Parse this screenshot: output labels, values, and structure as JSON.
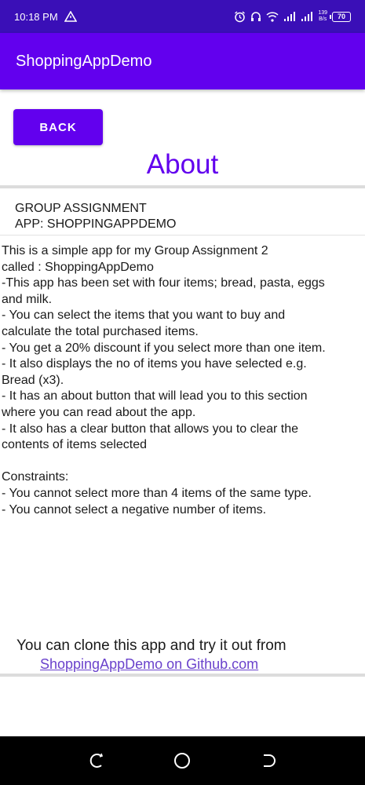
{
  "status_bar": {
    "time": "10:18 PM",
    "speed_value": "139",
    "speed_unit": "B/s",
    "battery": "70",
    "icons": [
      "warning-triangle-icon",
      "alarm-icon",
      "headset-icon",
      "wifi-icon",
      "signal-icon",
      "signal-icon",
      "battery-icon"
    ]
  },
  "app_bar": {
    "title": "ShoppingAppDemo"
  },
  "back_button": {
    "label": "BACK"
  },
  "page_title": "About",
  "group": {
    "line1": "GROUP ASSIGNMENT",
    "line2": "APP: SHOPPINGAPPDEMO"
  },
  "description": "This is a simple app for my Group Assignment 2\ncalled : ShoppingAppDemo\n-This app has been set with four items; bread, pasta, eggs\nand milk.\n- You can select the items that you want to buy and\ncalculate the total purchased items.\n- You get a 20% discount if you select more than one item.\n- It also displays the no of items you have selected e.g.\nBread (x3).\n- It has an about button that will lead you to this section\nwhere you can read about the app.\n- It also has a clear button that allows you to clear the\ncontents of items selected\n\nConstraints:\n- You cannot select more than 4 items of the same type.\n- You cannot select a negative number of items.",
  "clone_text": "You can clone this app and try it out from",
  "github_link": "ShoppingAppDemo on Github.com",
  "colors": {
    "status_bar": "#3a0fb7",
    "primary": "#6200ee",
    "link": "#6a42cc",
    "nav_bar": "#000000"
  },
  "nav_bar": {
    "icons": [
      "back-gesture-icon",
      "home-icon",
      "recents-icon"
    ]
  }
}
